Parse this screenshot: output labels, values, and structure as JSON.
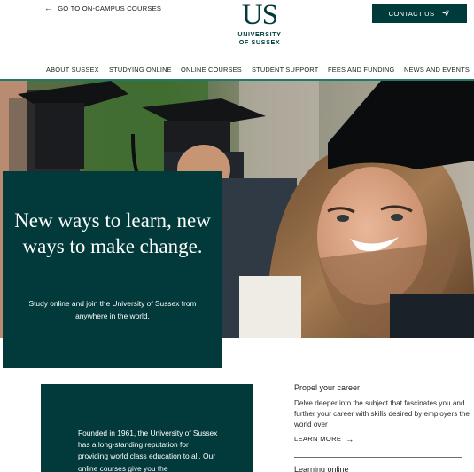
{
  "header": {
    "back_link": "GO TO ON-CAMPUS COURSES",
    "back_arrow": "🡐",
    "logo_monogram": "US",
    "logo_name_line1": "UNIVERSITY",
    "logo_name_line2": "OF SUSSEX",
    "contact_label": "CONTACT US",
    "contact_icon": "paper-plane-icon"
  },
  "nav": {
    "items": [
      "ABOUT SUSSEX",
      "STUDYING ONLINE",
      "ONLINE COURSES",
      "STUDENT SUPPORT",
      "FEES AND FUNDING",
      "NEWS AND EVENTS"
    ]
  },
  "hero": {
    "title": "New ways to learn, new ways to make change.",
    "subtitle": "Study online and join the University of Sussex from anywhere in the world."
  },
  "intro": {
    "text": "Founded in 1961, the University of Sussex has a long-standing reputation for providing world class education to all. Our online courses give you the"
  },
  "features": {
    "item1_title": "Propel your career",
    "item1_body": "Delve deeper into the subject that fascinates you and further your career with skills desired by employers the world over",
    "learn_more": "LEARN MORE",
    "learn_more_arrow": "🡒",
    "item2_title": "Learning online"
  },
  "colors": {
    "brand_dark_green": "#02393a",
    "nav_underline": "#1e7a6b",
    "text": "#1e2a2a"
  }
}
